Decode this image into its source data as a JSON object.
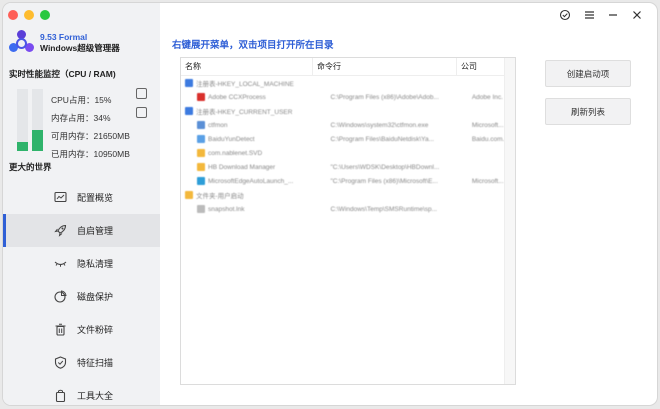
{
  "app": {
    "version": "9.53 Formal",
    "name": "Windows超级管理器"
  },
  "sidebar": {
    "perf_title": "实时性能监控（CPU / RAM)",
    "stats": {
      "cpu": "CPU占用：15%",
      "mem": "内存占用：34%",
      "avail": "可用内存：21650MB",
      "used": "已用内存：10950MB"
    },
    "cpu_fraction": 0.15,
    "mem_fraction": 0.34,
    "section_label": "更大的世界",
    "items": [
      {
        "label": "配置概览",
        "icon": "chart-icon"
      },
      {
        "label": "自启管理",
        "icon": "rocket-icon"
      },
      {
        "label": "隐私清理",
        "icon": "eye-closed-icon"
      },
      {
        "label": "磁盘保护",
        "icon": "pie-icon"
      },
      {
        "label": "文件粉碎",
        "icon": "trash-icon"
      },
      {
        "label": "特征扫描",
        "icon": "shield-icon"
      },
      {
        "label": "工具大全",
        "icon": "bag-icon"
      }
    ],
    "active_index": 1
  },
  "main": {
    "heading": "右键展开菜单，双击项目打开所在目录",
    "columns": {
      "name": "名称",
      "command": "命令行",
      "company": "公司"
    },
    "rows": [
      {
        "name": "注册表-HKEY_LOCAL_MACHINE",
        "cmd": "",
        "company": "",
        "color": "#3d7be0",
        "indent": 0
      },
      {
        "name": "Adobe CCXProcess",
        "cmd": "C:\\Program Files (x86)\\Adobe\\Adob...",
        "company": "Adobe Inc.",
        "color": "#d9302c",
        "indent": 1
      },
      {
        "name": "注册表-HKEY_CURRENT_USER",
        "cmd": "",
        "company": "",
        "color": "#3d7be0",
        "indent": 0
      },
      {
        "name": "ctfmon",
        "cmd": "C:\\Windows\\system32\\ctfmon.exe",
        "company": "Microsoft...",
        "color": "#5a8fd6",
        "indent": 1
      },
      {
        "name": "BaiduYunDetect",
        "cmd": "C:\\Program Files\\BaiduNetdisk\\Ya...",
        "company": "Baidu.com...",
        "color": "#5aa0e6",
        "indent": 1
      },
      {
        "name": "com.nablenet.SVD",
        "cmd": "",
        "company": "",
        "color": "#f3b83c",
        "indent": 1
      },
      {
        "name": "HB Download Manager",
        "cmd": "\"C:\\Users\\WDSK\\Desktop\\HBDownl...",
        "company": "",
        "color": "#f3b83c",
        "indent": 1
      },
      {
        "name": "MicrosoftEdgeAutoLaunch_...",
        "cmd": "\"C:\\Program Files (x86)\\Microsoft\\E...",
        "company": "Microsoft...",
        "color": "#2e9ed8",
        "indent": 1
      },
      {
        "name": "文件夹-用户启动",
        "cmd": "",
        "company": "",
        "color": "#f3b83c",
        "indent": 0
      },
      {
        "name": "snapshot.lnk",
        "cmd": "C:\\Windows\\Temp\\SMSRuntime\\sp...",
        "company": "",
        "color": "#bbbbbb",
        "indent": 1
      }
    ],
    "buttons": {
      "create": "创建启动项",
      "refresh": "刷新列表"
    }
  }
}
